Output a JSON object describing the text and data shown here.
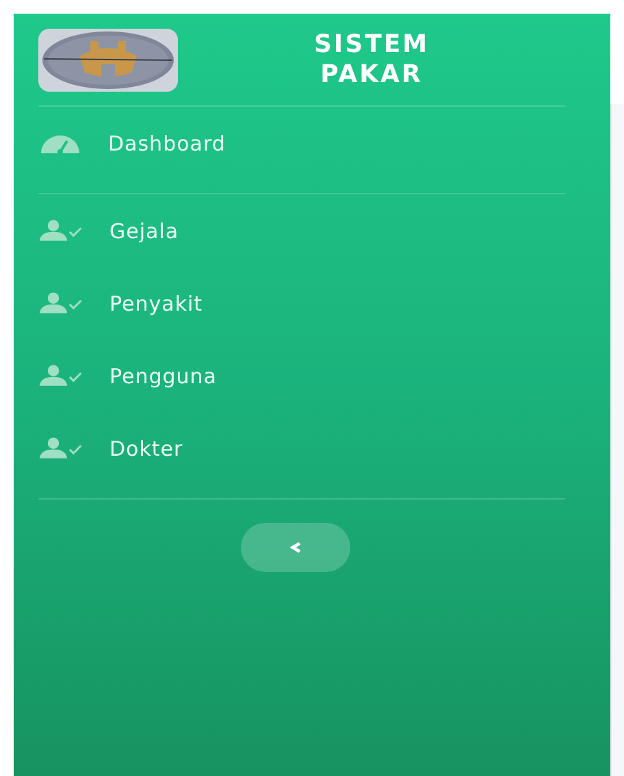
{
  "sidebar": {
    "brand": {
      "title": "SISTEM PAKAR"
    },
    "sections": [
      {
        "items": [
          {
            "label": "Dashboard",
            "kind": "gauge"
          }
        ]
      },
      {
        "items": [
          {
            "label": "Gejala",
            "kind": "user"
          },
          {
            "label": "Penyakit",
            "kind": "user"
          },
          {
            "label": "Pengguna",
            "kind": "user"
          },
          {
            "label": "Dokter",
            "kind": "user"
          }
        ]
      }
    ],
    "toggle": {
      "kind": "collapse"
    }
  }
}
